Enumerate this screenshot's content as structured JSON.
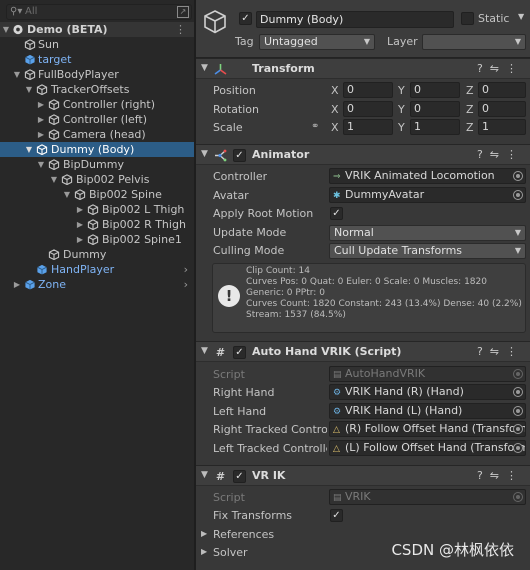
{
  "hierarchy": {
    "search_placeholder": "All",
    "rows": [
      {
        "label": "Demo (BETA)"
      },
      {
        "label": "Sun"
      },
      {
        "label": "target"
      },
      {
        "label": "FullBodyPlayer"
      },
      {
        "label": "TrackerOffsets"
      },
      {
        "label": "Controller (right)"
      },
      {
        "label": "Controller (left)"
      },
      {
        "label": "Camera (head)"
      },
      {
        "label": "Dummy (Body)"
      },
      {
        "label": "BipDummy"
      },
      {
        "label": "Bip002 Pelvis"
      },
      {
        "label": "Bip002 Spine"
      },
      {
        "label": "Bip002 L Thigh"
      },
      {
        "label": "Bip002 R Thigh"
      },
      {
        "label": "Bip002 Spine1"
      },
      {
        "label": "Dummy"
      },
      {
        "label": "HandPlayer"
      },
      {
        "label": "Zone"
      }
    ]
  },
  "inspector": {
    "object_name": "Dummy (Body)",
    "static_label": "Static",
    "tag_label": "Tag",
    "tag_value": "Untagged",
    "layer_label": "Layer",
    "layer_value": "",
    "transform": {
      "title": "Transform",
      "position_label": "Position",
      "rotation_label": "Rotation",
      "scale_label": "Scale",
      "axis_x": "X",
      "axis_y": "Y",
      "axis_z": "Z",
      "position": [
        "0",
        "0",
        "0"
      ],
      "rotation": [
        "0",
        "0",
        "0"
      ],
      "scale": [
        "1",
        "1",
        "1"
      ]
    },
    "animator": {
      "title": "Animator",
      "controller_label": "Controller",
      "controller_value": "VRIK Animated Locomotion",
      "avatar_label": "Avatar",
      "avatar_value": "DummyAvatar",
      "apply_root_motion_label": "Apply Root Motion",
      "update_mode_label": "Update Mode",
      "update_mode_value": "Normal",
      "culling_mode_label": "Culling Mode",
      "culling_mode_value": "Cull Update Transforms",
      "info_text": "Clip Count: 14\nCurves Pos: 0 Quat: 0 Euler: 0 Scale: 0 Muscles: 1820 Generic: 0 PPtr: 0\nCurves Count: 1820 Constant: 243 (13.4%) Dense: 40 (2.2%)\nStream: 1537 (84.5%)"
    },
    "auto_hand_vrik": {
      "title": "Auto Hand VRIK (Script)",
      "script_label": "Script",
      "script_value": "AutoHandVRIK",
      "right_hand_label": "Right Hand",
      "right_hand_value": "VRIK Hand (R) (Hand)",
      "left_hand_label": "Left Hand",
      "left_hand_value": "VRIK Hand (L) (Hand)",
      "right_tracked_label": "Right Tracked Control",
      "right_tracked_value": "(R) Follow Offset Hand (Transform)",
      "left_tracked_label": "Left Tracked Controlle",
      "left_tracked_value": "(L) Follow Offset Hand (Transform)"
    },
    "vrik": {
      "title": "VR IK",
      "script_label": "Script",
      "script_value": "VRIK",
      "fix_transforms_label": "Fix Transforms",
      "references_label": "References",
      "solver_label": "Solver"
    }
  },
  "watermark": "CSDN @林枫依依",
  "colors": {
    "selection": "#2c5d87",
    "prefab_blue": "#7fb4f5",
    "panel_bg": "#383838",
    "hierarchy_bg": "#282828"
  }
}
